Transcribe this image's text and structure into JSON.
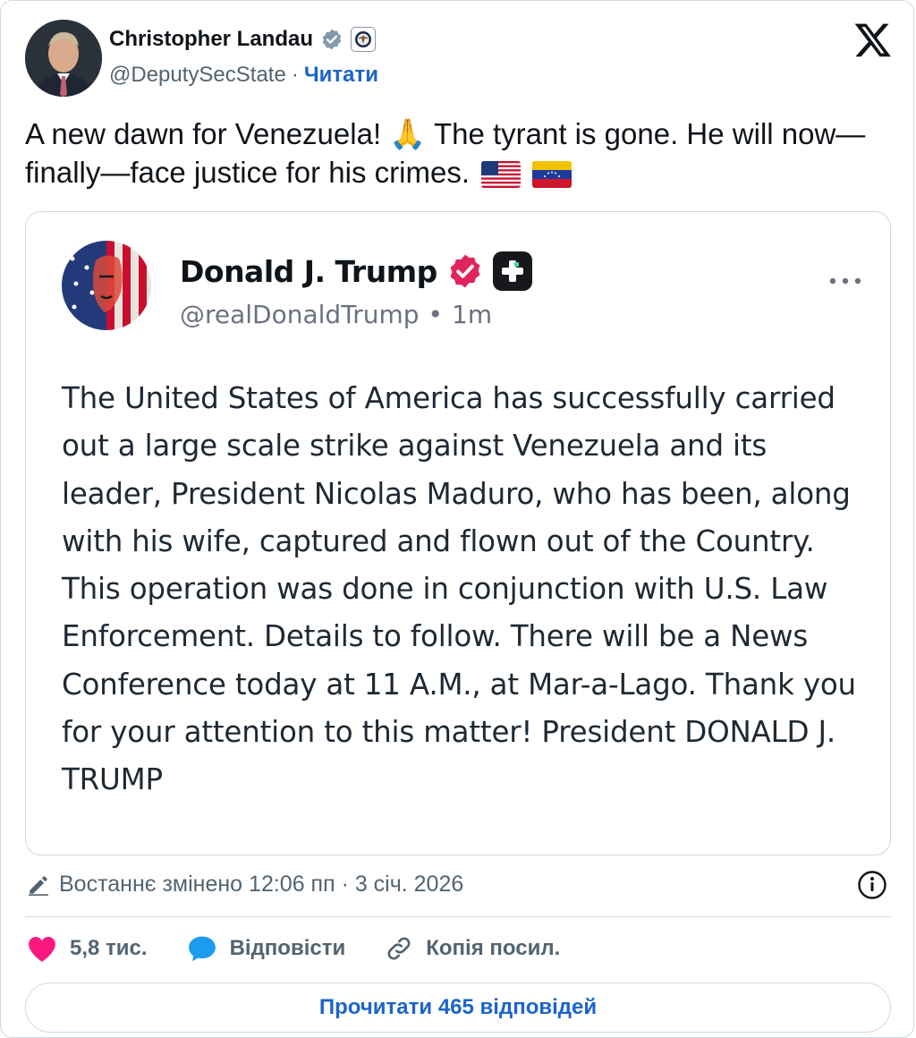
{
  "author": {
    "name": "Christopher Landau",
    "handle": "@DeputySecState",
    "separator": "·",
    "follow_label": "Читати"
  },
  "tweet": {
    "text": "A new dawn for Venezuela! 🙏 The tyrant is gone. He will now—finally—face justice for his crimes."
  },
  "quoted_post": {
    "name": "Donald J. Trump",
    "handle": "@realDonaldTrump",
    "separator": "•",
    "time": "1m",
    "body": "The United States of America has successfully carried out a large scale strike against Venezuela and its leader, President Nicolas Maduro, who has been, along with his wife, captured and flown out of the Country. This operation was done in conjunction with U.S. Law Enforcement. Details to follow. There will be a News Conference today at 11 A.M., at Mar-a-Lago. Thank you for your attention to this matter! President DONALD J. TRUMP"
  },
  "meta": {
    "edited_label": "Востаннє змінено 12:06 пп · 3 січ. 2026"
  },
  "actions": {
    "likes": "5,8 тис.",
    "reply_label": "Відповісти",
    "copy_label": "Копія посил."
  },
  "read_replies_label": "Прочитати 465 відповідей",
  "colors": {
    "link_blue": "#1d64c8",
    "like_pink": "#f91880",
    "reply_blue": "#1d9bf0",
    "verified_pink": "#e0245e",
    "muted_text": "#536471",
    "border": "#cfd9de"
  },
  "icons": [
    "verified-gray-icon",
    "government-seal-icon",
    "x-logo-icon",
    "verified-pink-icon",
    "plus-app-icon",
    "more-icon",
    "pencil-icon",
    "info-icon",
    "heart-icon",
    "reply-bubble-icon",
    "link-icon",
    "us-flag-icon",
    "venezuela-flag-icon"
  ]
}
